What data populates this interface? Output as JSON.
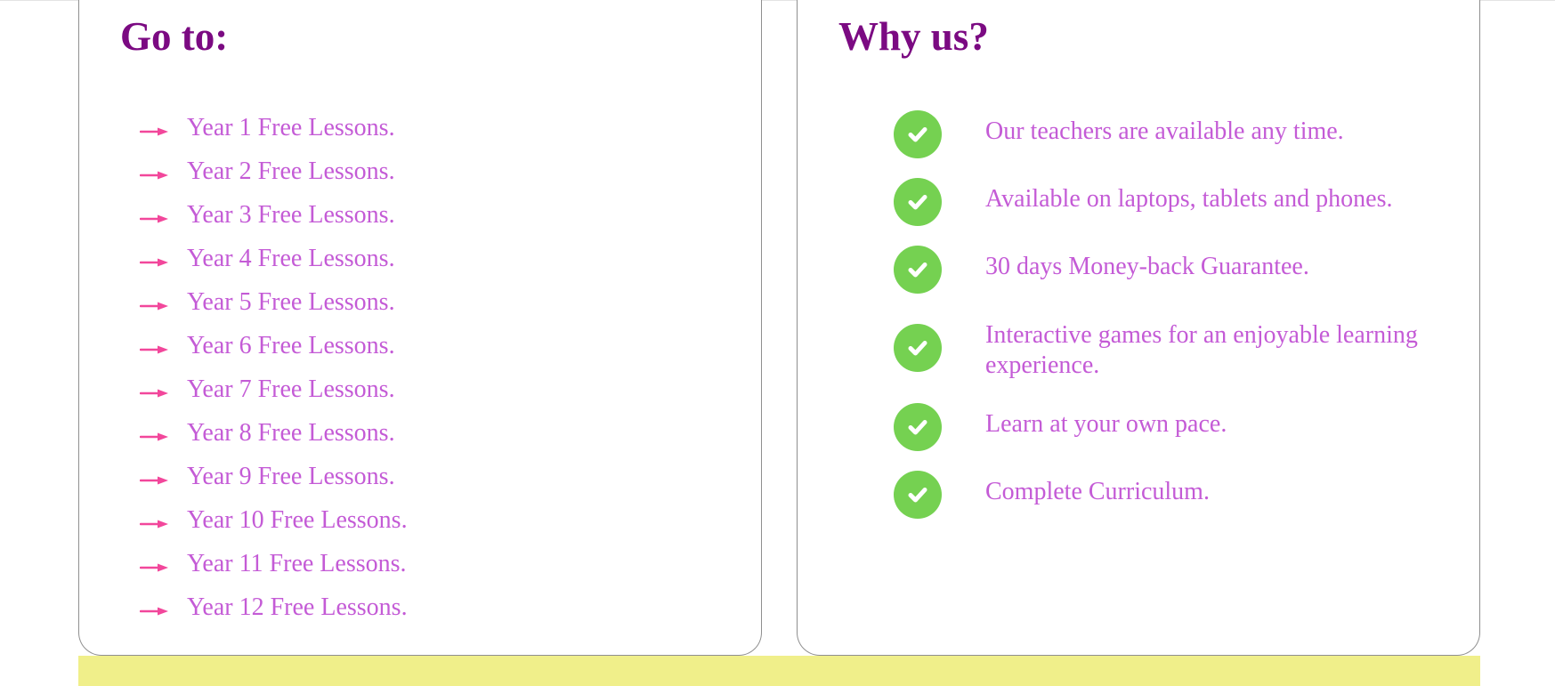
{
  "colors": {
    "heading": "#7b0a82",
    "text": "#c45bd6",
    "arrow": "#f2479b",
    "check": "#75d151",
    "footer": "#f0ef8a"
  },
  "goto": {
    "title": "Go to:",
    "arrow_icon": "arrow-right-icon",
    "links": [
      "Year 1 Free Lessons.",
      "Year 2 Free Lessons.",
      "Year 3 Free Lessons.",
      "Year 4 Free Lessons.",
      "Year 5 Free Lessons.",
      "Year 6 Free Lessons.",
      "Year 7 Free Lessons.",
      "Year 8 Free Lessons.",
      "Year 9 Free Lessons.",
      "Year 10 Free Lessons.",
      "Year 11 Free Lessons.",
      "Year 12 Free Lessons."
    ]
  },
  "why": {
    "title": "Why us?",
    "check_icon": "check-circle-icon",
    "features": [
      "Our teachers are available any time.",
      "Available on laptops, tablets and phones.",
      "30 days Money-back Guarantee.",
      "Interactive games for an enjoyable learning experience.",
      "Learn at your own pace.",
      "Complete Curriculum."
    ]
  }
}
